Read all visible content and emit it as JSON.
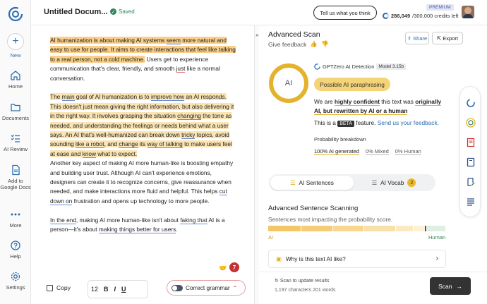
{
  "app": {
    "doc_title": "Untitled Docum...",
    "saved": "Saved"
  },
  "topbar": {
    "tell_label": "Tell us what you think",
    "premium": "PREMIUM",
    "credits_used": "286,049",
    "credits_total": "/300,000 credits left"
  },
  "sidebar": {
    "items": [
      {
        "label": "New",
        "icon": "plus-icon"
      },
      {
        "label": "Home",
        "icon": "home-icon"
      },
      {
        "label": "Documents",
        "icon": "folder-icon"
      },
      {
        "label": "AI Review",
        "icon": "list-check-icon"
      },
      {
        "label": "Add to Google Docs",
        "icon": "google-docs-icon"
      },
      {
        "label": "More",
        "icon": "dots-icon"
      },
      {
        "label": "Help",
        "icon": "help-icon"
      },
      {
        "label": "Settings",
        "icon": "gear-icon"
      }
    ]
  },
  "editor": {
    "p1": {
      "s1": "AI humanization is about making AI systems ",
      "s1b": "seem",
      "s1c": " more natural and easy to use for people.",
      "s2": " It aims to create interactions that feel like talking to a real person, not a cold machine.",
      "s3": " Users get to experience communication that's clear, friendly, and smooth ",
      "s3b": "just",
      "s3c": " like a normal conversation."
    },
    "p2": {
      "a": "The ",
      "b": "main",
      "c": " goal of AI humanization is to ",
      "d": "improve how",
      "e": " an AI responds. This doesn't just mean giving the right information, but also delivering it in the right way. It involves grasping the situation ",
      "f": "changing",
      "g": " the tone as needed, and understanding the feelings or needs behind what a user says. An AI that's well-humanized can break down ",
      "h": "tricky",
      "i": " topics, avoid sounding ",
      "j": "like a robot",
      "k": ", and ",
      "l": "change",
      "m": " its ",
      "n": "way of talking",
      "o": " to make users feel at ease and ",
      "p": "know",
      "q": " what to expect."
    },
    "p3": {
      "a": "Another key aspect of making AI more human-like is boosting empathy and building user trust. Although AI can't experience emotions, designers can create it to recognize concerns, give reassurance when needed, and make interactions more fluid and helpful. This helps ",
      "b": "cut down on",
      "c": " frustration and opens up technology to more people."
    },
    "p4": {
      "a": "In the end",
      "b": ", making AI more human-like isn't about ",
      "c": "faking that",
      "d": " AI is a person—it's about ",
      "e": "making things better for users",
      "f": "."
    },
    "badge_count": "7",
    "emoji": "🤝"
  },
  "toolbar": {
    "copy": "Copy",
    "font_size": "12",
    "bold": "B",
    "italic": "I",
    "underline": "U",
    "grammar": "Correct grammar"
  },
  "panel": {
    "title": "Advanced Scan",
    "feedback": "Give feedback",
    "share": "Share",
    "export": "Export",
    "ring_label": "AI",
    "detector": "GPTZero AI Detection",
    "model": "Model 3.15b",
    "verdict": "Possible AI paraphrasing",
    "verdict_pre": "We are ",
    "verdict_bold": "highly confident",
    "verdict_mid": " this text was ",
    "verdict_bold2": "originally AI, but rewritten by AI or a human",
    "beta_pre": "This is a ",
    "beta": "BETA",
    "beta_mid": " feature. ",
    "beta_link": "Send us your feedback.",
    "prob_title": "Probability breakdown",
    "prob_ai": "100% AI generated",
    "prob_mixed": "0% Mixed",
    "prob_human": "0% Human",
    "tab_sentences": "AI Sentences",
    "tab_vocab": "AI Vocab",
    "vocab_count": "2",
    "adv_title": "Advanced Sentence Scanning",
    "adv_sub": "Sentences most impacting the probability score.",
    "bar_left": "AI",
    "bar_right": "Human",
    "why": "Why is this text AI like?",
    "scan_update": "Scan to update results",
    "scan_meta": "1,197 characters 201 words",
    "scan_btn": "Scan"
  },
  "colors": {
    "accent": "#2b6cb0",
    "ai_yellow": "#e3b32c",
    "highlight": "#f9cf8a",
    "dark": "#333333"
  }
}
